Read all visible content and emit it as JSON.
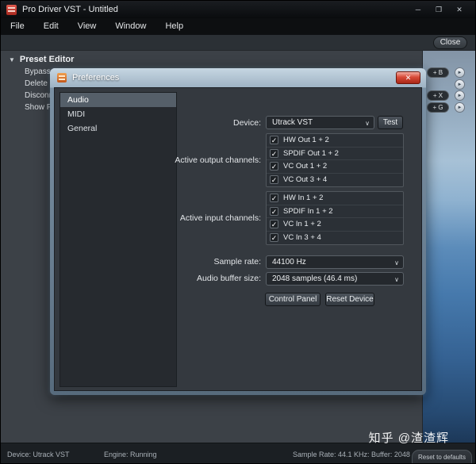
{
  "window": {
    "title": "Pro Driver VST - Untitled"
  },
  "icons": {
    "minimize": "─",
    "maximize": "❐",
    "close": "✕",
    "dialog_close": "✕",
    "chevron": "∨",
    "check": "✓",
    "triangle_down": "▼",
    "round_action": "►"
  },
  "menu": {
    "items": [
      "File",
      "Edit",
      "View",
      "Window",
      "Help"
    ]
  },
  "toolbar": {
    "close_label": "Close"
  },
  "preset_editor": {
    "title": "Preset Editor",
    "items": [
      "Bypass F",
      "Delete P",
      "Disconn",
      "Show Pl"
    ],
    "shortcuts": [
      "+ B",
      "+ X",
      "+ G"
    ]
  },
  "preferences": {
    "title": "Preferences",
    "tabs": [
      "Audio",
      "MIDI",
      "General"
    ],
    "selected_tab": "Audio",
    "device": {
      "label": "Device:",
      "value": "Utrack VST",
      "test_label": "Test"
    },
    "output": {
      "label": "Active output channels:",
      "channels": [
        "HW Out 1 + 2",
        "SPDIF Out 1 + 2",
        "VC Out 1 + 2",
        "VC Out 3 + 4"
      ]
    },
    "input": {
      "label": "Active input channels:",
      "channels": [
        "HW In 1 + 2",
        "SPDIF In 1 + 2",
        "VC In 1 + 2",
        "VC In 3 + 4"
      ]
    },
    "sample_rate": {
      "label": "Sample rate:",
      "value": "44100 Hz"
    },
    "buffer": {
      "label": "Audio buffer size:",
      "value": "2048 samples (46.4 ms)"
    },
    "buttons": {
      "control_panel": "Control Panel",
      "reset_device": "Reset Device"
    }
  },
  "status_bar": {
    "device": "Device: Utrack VST",
    "engine": "Engine: Running",
    "sample": "Sample Rate: 44.1 KHz:  Buffer: 2048"
  },
  "watermark": "知乎 @渣渣辉",
  "reset_defaults_label": "Reset to defaults"
}
